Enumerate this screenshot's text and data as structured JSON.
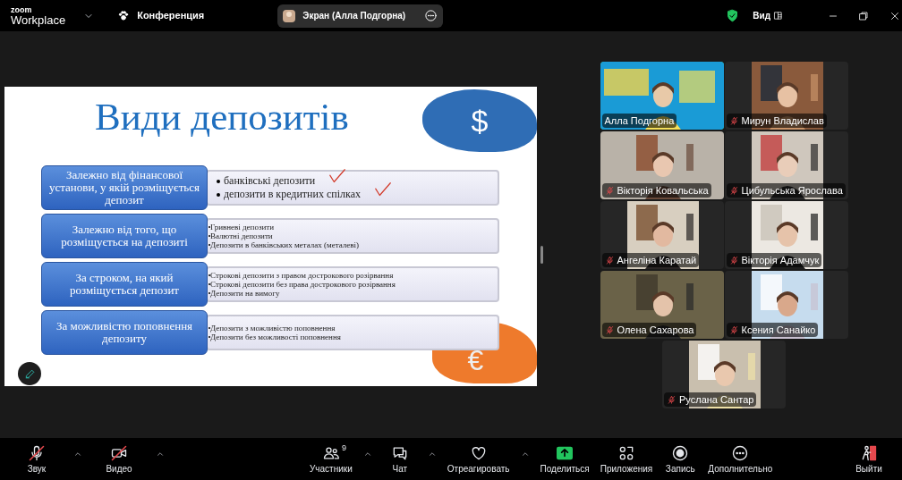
{
  "app": {
    "logo_top": "zoom",
    "logo_bottom": "Workplace",
    "meeting_menu": "Конференция",
    "share_pill": "Экран (Алла Подгорна)",
    "view_menu": "Вид"
  },
  "slide": {
    "title": "Види депозитів",
    "currency_top": "$",
    "currency_bottom": "€",
    "rows": [
      {
        "category": "Залежно від фінансової установи, у якій розміщується депозит",
        "kind": "large",
        "items": [
          {
            "text": "банківські депозити",
            "ticked": true
          },
          {
            "text": "депозити в кредитних спілках",
            "ticked": true
          }
        ]
      },
      {
        "category": "Залежно від того, що розміщується на депозиті",
        "kind": "small",
        "items": [
          {
            "text": "Гривневі депозити",
            "ticked": false
          },
          {
            "text": "Валютні депозити",
            "ticked": false
          },
          {
            "text": "Депозити в банківських металах (металеві)",
            "ticked": false
          }
        ]
      },
      {
        "category": "За строком, на який розміщується депозит",
        "kind": "small",
        "items": [
          {
            "text": "Строкові депозити з правом дострокового розірвання",
            "ticked": false
          },
          {
            "text": "Строкові депозити без права дострокового розірвання",
            "ticked": false
          },
          {
            "text": "Депозити на вимогу",
            "ticked": false
          }
        ]
      },
      {
        "category": "За можливістю поповнення депозиту",
        "kind": "small",
        "items": [
          {
            "text": "Депозити з можливістю поповнення",
            "ticked": false
          },
          {
            "text": "Депозити без можливості поповнення",
            "ticked": false
          }
        ]
      }
    ]
  },
  "participants": [
    {
      "name": "Алла Подгорна",
      "muted": false,
      "speaking": true,
      "kind": "picture"
    },
    {
      "name": "Мирун Владислав",
      "muted": true,
      "speaking": false,
      "kind": "picture"
    },
    {
      "name": "Вікторія Ковальська",
      "muted": true,
      "speaking": false,
      "kind": "picture"
    },
    {
      "name": "Цибульська Ярослава",
      "muted": true,
      "speaking": false,
      "kind": "picture"
    },
    {
      "name": "Ангеліна Каратай",
      "muted": true,
      "speaking": false,
      "kind": "picture"
    },
    {
      "name": "Вікторія Адамчук",
      "muted": true,
      "speaking": false,
      "kind": "picture"
    },
    {
      "name": "Олена Сахарова",
      "muted": true,
      "speaking": false,
      "kind": "picture"
    },
    {
      "name": "Ксения Санайко",
      "muted": true,
      "speaking": false,
      "kind": "picture"
    },
    {
      "name": "Руслана Сантар",
      "muted": true,
      "speaking": false,
      "kind": "picture"
    }
  ],
  "toolbar": {
    "left": [
      {
        "kind": "mic",
        "label": "Звук",
        "off": true,
        "caret": true
      },
      {
        "kind": "video",
        "label": "Видео",
        "off": true,
        "caret": true
      }
    ],
    "center": [
      {
        "kind": "people",
        "label": "Участники",
        "badge": "9",
        "caret": true
      },
      {
        "kind": "chat",
        "label": "Чат",
        "caret": true
      },
      {
        "kind": "heart",
        "label": "Отреагировать",
        "caret": true
      },
      {
        "kind": "share",
        "label": "Поделиться",
        "caret": false
      },
      {
        "kind": "apps",
        "label": "Приложения",
        "caret": false
      },
      {
        "kind": "record",
        "label": "Запись",
        "caret": false
      },
      {
        "kind": "more",
        "label": "Дополнительно",
        "caret": false
      }
    ],
    "right": [
      {
        "kind": "leave",
        "label": "Выйти",
        "caret": false
      }
    ]
  }
}
